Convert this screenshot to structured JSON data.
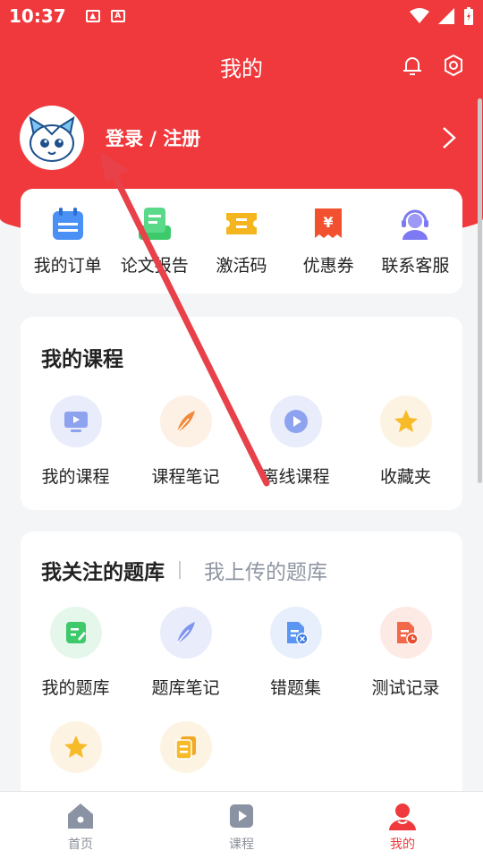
{
  "status_bar": {
    "time": "10:37"
  },
  "header": {
    "title": "我的"
  },
  "profile": {
    "login_label": "登录 / 注册"
  },
  "quick_links": [
    {
      "label": "我的订单",
      "icon": "calendar-icon",
      "color": "#4a90f5"
    },
    {
      "label": "论文报告",
      "icon": "report-icon",
      "color": "#3ec96b"
    },
    {
      "label": "激活码",
      "icon": "ticket-icon",
      "color": "#f5b51f"
    },
    {
      "label": "优惠券",
      "icon": "coupon-icon",
      "color": "#f2512f"
    },
    {
      "label": "联系客服",
      "icon": "support-icon",
      "color": "#7c79f2"
    }
  ],
  "courses": {
    "title": "我的课程",
    "items": [
      {
        "label": "我的课程",
        "icon": "monitor-icon"
      },
      {
        "label": "课程笔记",
        "icon": "feather-icon"
      },
      {
        "label": "离线课程",
        "icon": "play-icon"
      },
      {
        "label": "收藏夹",
        "icon": "star-icon"
      }
    ]
  },
  "question_bank": {
    "tab_followed": "我关注的题库",
    "tab_uploaded": "我上传的题库",
    "items": [
      {
        "label": "我的题库",
        "icon": "edit-doc-icon"
      },
      {
        "label": "题库笔记",
        "icon": "feather-icon"
      },
      {
        "label": "错题集",
        "icon": "error-doc-icon"
      },
      {
        "label": "测试记录",
        "icon": "clock-doc-icon"
      }
    ],
    "extra_icons": [
      "star-icon",
      "copy-icon"
    ]
  },
  "bottom_nav": [
    {
      "label": "首页",
      "icon": "home-icon"
    },
    {
      "label": "课程",
      "icon": "play-square-icon"
    },
    {
      "label": "我的",
      "icon": "user-icon"
    }
  ],
  "colors": {
    "brand_red": "#f0393c",
    "annotation_arrow": "#e8414a"
  }
}
